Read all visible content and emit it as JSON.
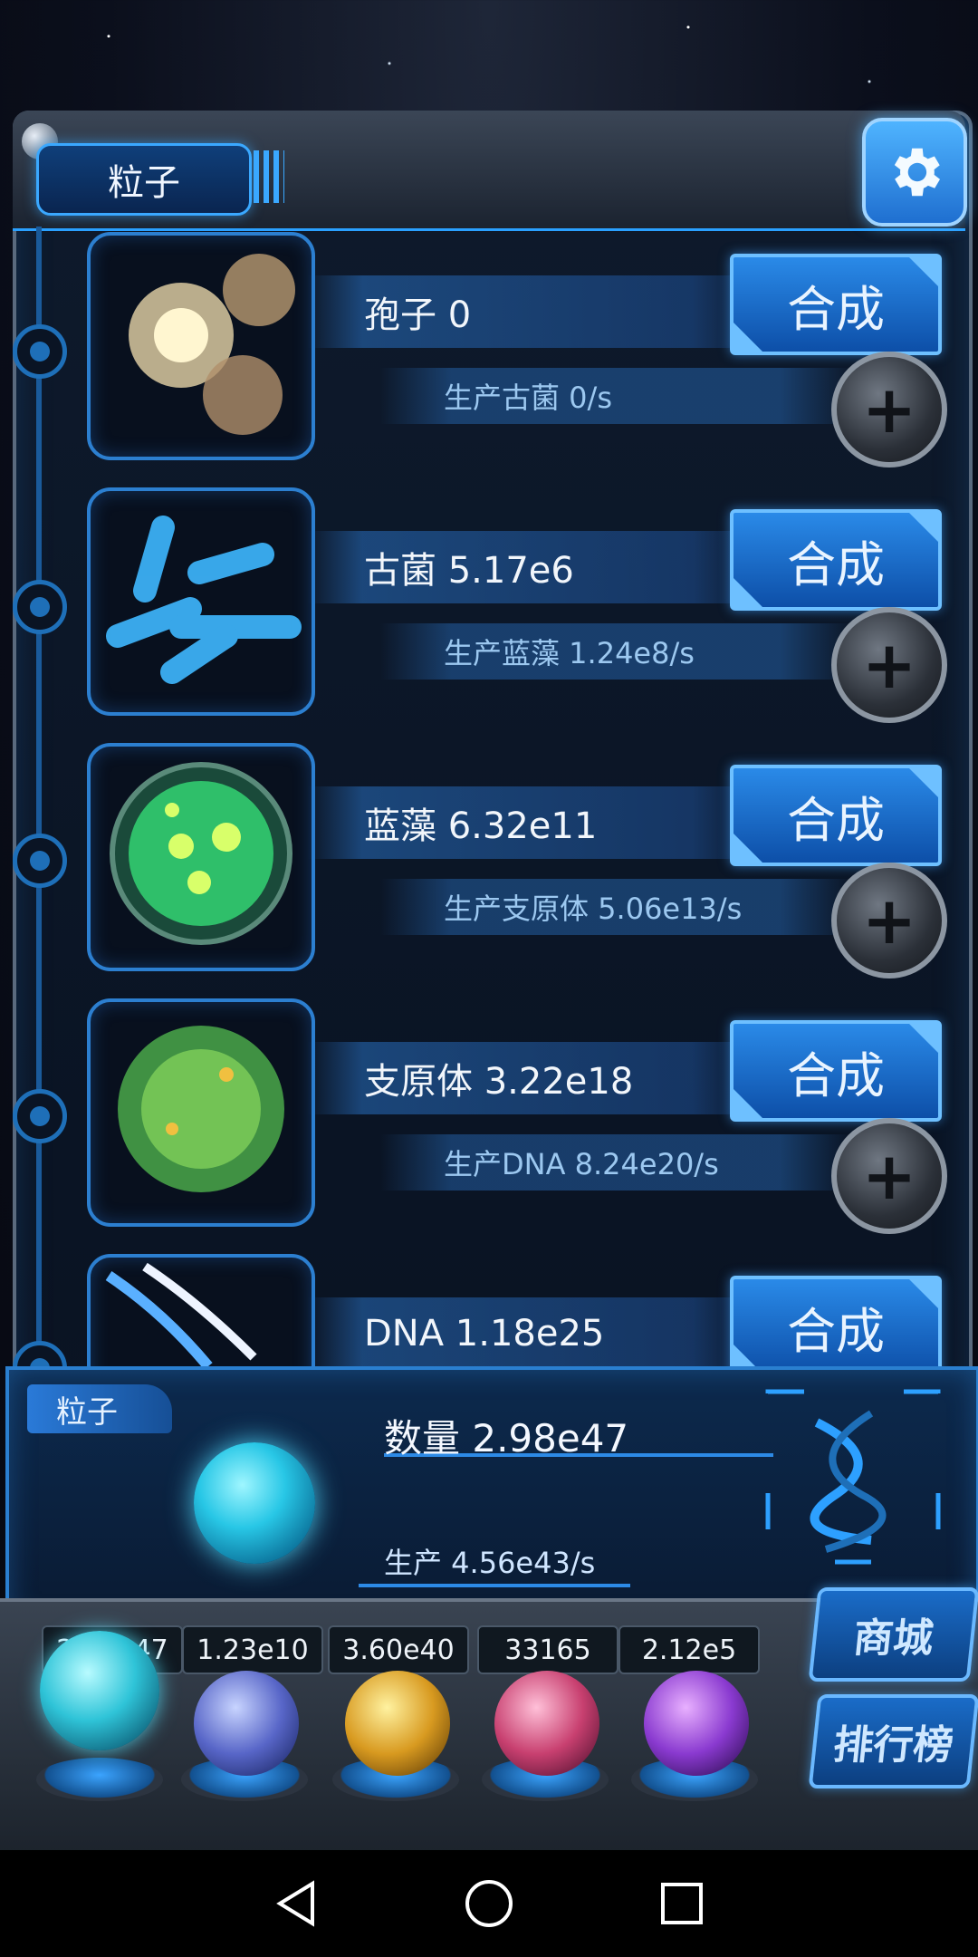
{
  "header": {
    "title": "粒子"
  },
  "items": [
    {
      "name": "孢子 0",
      "craft_label": "合成",
      "production": "生产古菌 0/s"
    },
    {
      "name": "古菌 5.17e6",
      "craft_label": "合成",
      "production": "生产蓝藻 1.24e8/s"
    },
    {
      "name": "蓝藻 6.32e11",
      "craft_label": "合成",
      "production": "生产支原体 5.06e13/s"
    },
    {
      "name": "支原体 3.22e18",
      "craft_label": "合成",
      "production": "生产DNA 8.24e20/s"
    },
    {
      "name": "DNA 1.18e25",
      "craft_label": "合成"
    }
  ],
  "info_panel": {
    "tab": "粒子",
    "count": "数量 2.98e47",
    "production": "生产 4.56e43/s"
  },
  "resources": {
    "values": [
      "2.98e47",
      "1.23e10",
      "3.60e40",
      "33165",
      "2.12e5"
    ]
  },
  "side_buttons": {
    "shop": "商城",
    "leaderboard": "排行榜"
  },
  "colors": {
    "accent": "#2a8ae8",
    "panel": "#0a1424",
    "text": "#f2f6fb"
  }
}
